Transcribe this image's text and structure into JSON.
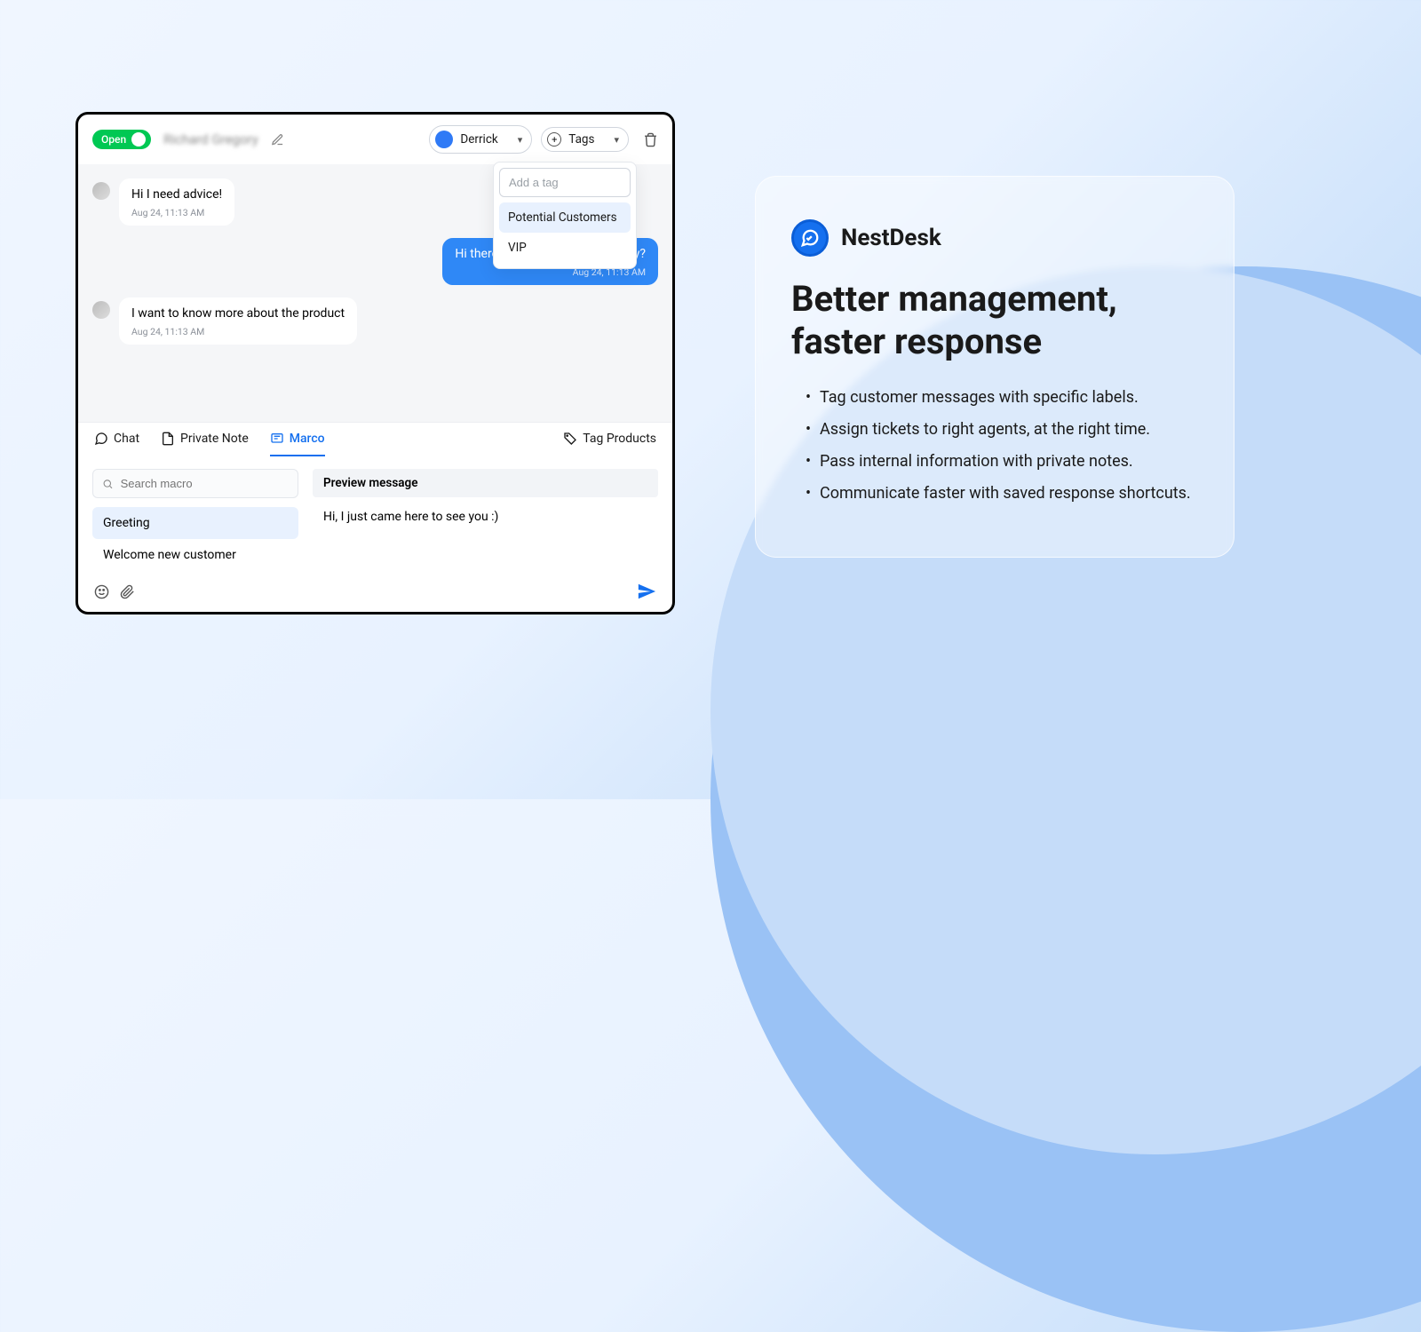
{
  "header": {
    "status_label": "Open",
    "customer_name": "Richard Gregory",
    "agent_name": "Derrick",
    "tags_label": "Tags"
  },
  "tag_popover": {
    "placeholder": "Add a tag",
    "options": [
      "Potential Customers",
      "VIP"
    ]
  },
  "messages": [
    {
      "from": "customer",
      "text": "Hi I need advice!",
      "time": "Aug 24, 11:13 AM"
    },
    {
      "from": "agent",
      "text": "Hi there, how can I help you today?",
      "time": "Aug 24, 11:13 AM"
    },
    {
      "from": "customer",
      "text": "I want to know more about the product",
      "time": "Aug 24, 11:13 AM"
    }
  ],
  "composer": {
    "tabs": {
      "chat": "Chat",
      "private_note": "Private Note",
      "macro": "Marco",
      "tag_products": "Tag Products"
    },
    "search_placeholder": "Search macro",
    "macros": [
      "Greeting",
      "Welcome new customer"
    ],
    "preview_label": "Preview message",
    "preview_text": "Hi, I just came here to see you :)"
  },
  "marketing": {
    "brand": "NestDesk",
    "title": "Better management, faster response",
    "features": [
      "Tag customer messages with specific labels.",
      "Assign tickets to right agents, at the right time.",
      "Pass internal information with private notes.",
      "Communicate faster with saved response shortcuts."
    ]
  }
}
